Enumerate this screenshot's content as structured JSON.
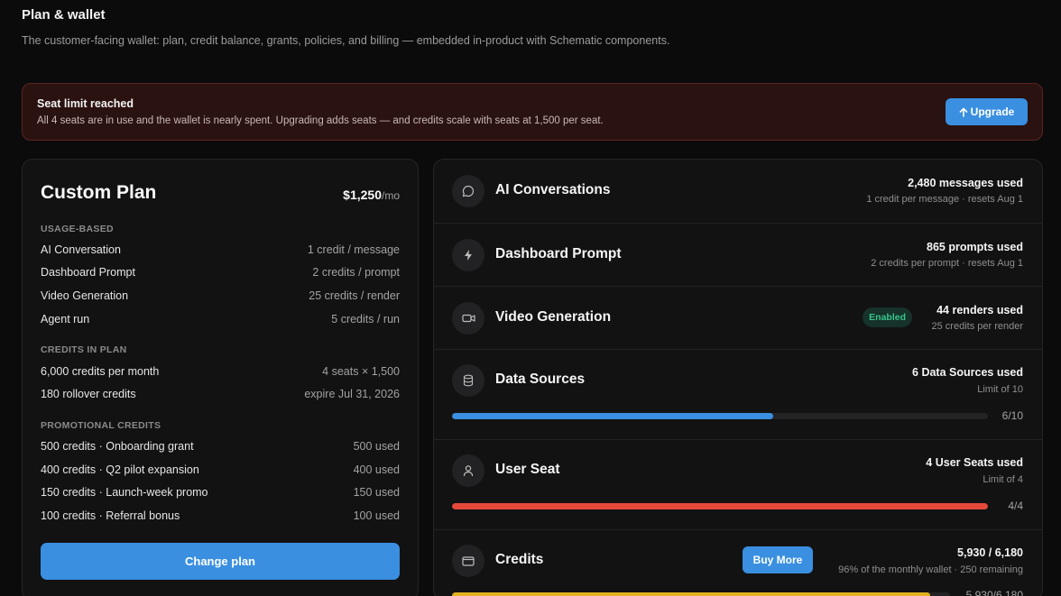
{
  "header": {
    "title": "Plan & wallet",
    "description": "The customer-facing wallet: plan, credit balance, grants, policies, and billing — embedded in-product with Schematic components."
  },
  "alert": {
    "title": "Seat limit reached",
    "text": "All 4 seats are in use and the wallet is nearly spent. Upgrading adds seats — and credits scale with seats at 1,500 per seat.",
    "button_label": "Upgrade",
    "button_icon": "arrow-up-icon"
  },
  "plan": {
    "name": "Custom Plan",
    "price": "$1,250",
    "period": "/mo",
    "usage_label": "USAGE-BASED",
    "usage": [
      {
        "name": "AI Conversation",
        "rate": "1 credit / message"
      },
      {
        "name": "Dashboard Prompt",
        "rate": "2 credits / prompt"
      },
      {
        "name": "Video Generation",
        "rate": "25 credits / render"
      },
      {
        "name": "Agent run",
        "rate": "5 credits / run"
      }
    ],
    "credits_label": "CREDITS IN PLAN",
    "credits": [
      {
        "name": "6,000 credits per month",
        "detail": "4 seats × 1,500"
      },
      {
        "name": "180 rollover credits",
        "detail": "expire Jul 31, 2026"
      }
    ],
    "promo_label": "PROMOTIONAL CREDITS",
    "promos": [
      {
        "name": "500 credits · Onboarding grant",
        "used": "500 used"
      },
      {
        "name": "400 credits · Q2 pilot expansion",
        "used": "400 used"
      },
      {
        "name": "150 credits · Launch-week promo",
        "used": "150 used"
      },
      {
        "name": "100 credits · Referral bonus",
        "used": "100 used"
      }
    ],
    "change_label": "Change plan"
  },
  "usage_items": [
    {
      "name": "AI Conversations",
      "icon": "chat-bubble-icon",
      "main": "2,480 messages used",
      "sub": "1 credit per message · resets Aug 1"
    },
    {
      "name": "Dashboard Prompt",
      "icon": "lightning-icon",
      "main": "865 prompts used",
      "sub": "2 credits per prompt · resets Aug 1"
    },
    {
      "name": "Video Generation",
      "icon": "video-camera-icon",
      "badge": "Enabled",
      "main": "44 renders used",
      "sub": "25 credits per render"
    },
    {
      "name": "Data Sources",
      "icon": "database-icon",
      "main": "6 Data Sources used",
      "sub": "Limit of 10",
      "bar_value": "6/10",
      "fraction": 0.6,
      "bar_color": "#3a8fe0"
    },
    {
      "name": "User Seat",
      "icon": "user-icon",
      "main": "4 User Seats used",
      "sub": "Limit of 4",
      "bar_value": "4/4",
      "fraction": 1.0,
      "bar_color": "#e5493a"
    },
    {
      "name": "Credits",
      "icon": "wallet-icon",
      "main": "5,930 / 6,180",
      "sub": "96% of the monthly wallet · 250 remaining",
      "bar_value": "5,930/6,180",
      "fraction": 0.96,
      "bar_color": "#e3b021",
      "button_label": "Buy More"
    }
  ]
}
